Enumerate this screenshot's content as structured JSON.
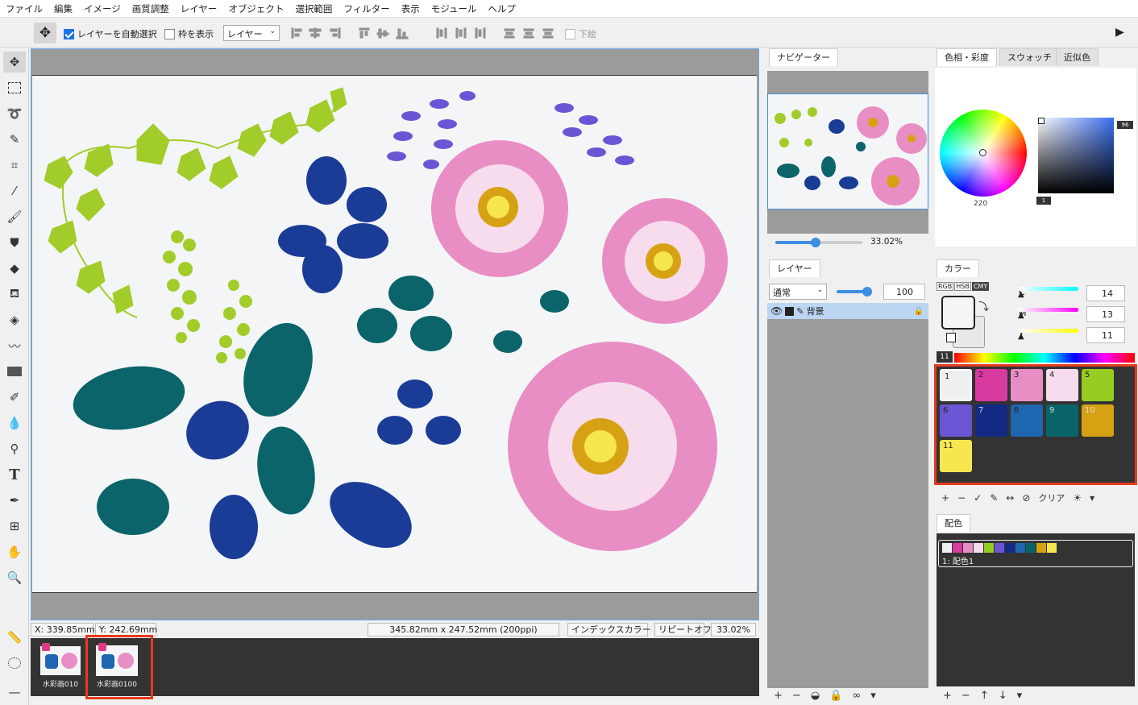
{
  "menu": [
    "ファイル",
    "編集",
    "イメージ",
    "画質調整",
    "レイヤー",
    "オブジェクト",
    "選択範囲",
    "フィルター",
    "表示",
    "モジュール",
    "ヘルプ"
  ],
  "options": {
    "auto_select_label": "レイヤーを自動選択",
    "show_bounds_label": "枠を表示",
    "target_select": "レイヤー",
    "bottom_label": "下絵"
  },
  "status": {
    "x": "X: 339.85mm",
    "y": "Y: 242.69mm",
    "size": "345.82mm x 247.52mm (200ppi)",
    "color_mode": "インデックスカラー",
    "repeat": "リピートオフ",
    "zoom": "33.02%"
  },
  "documents": [
    {
      "name": "水彩画010"
    },
    {
      "name": "水彩画0100"
    }
  ],
  "navigator": {
    "tab": "ナビゲーター",
    "zoom": "33.02%"
  },
  "layers": {
    "tab": "レイヤー",
    "blend": "通常",
    "opacity": "100",
    "items": [
      {
        "name": "背景"
      }
    ]
  },
  "color_tabs": [
    "色相・彩度",
    "スウォッチ",
    "近似色"
  ],
  "hue_value": "220",
  "sat_value": "96",
  "bright_value": "1",
  "color_panel": {
    "tab": "カラー",
    "modes": [
      "RGB",
      "HSB",
      "CMY"
    ],
    "c_label": "C",
    "c_value": "14",
    "m_label": "M",
    "m_value": "13",
    "y_label": "Y",
    "y_value": "11",
    "palette_index": "11"
  },
  "palette": [
    {
      "num": "1",
      "color": "#eeeff0"
    },
    {
      "num": "2",
      "color": "#d83aa0"
    },
    {
      "num": "3",
      "color": "#e98ec4"
    },
    {
      "num": "4",
      "color": "#f6dced"
    },
    {
      "num": "5",
      "color": "#97cc22"
    },
    {
      "num": "6",
      "color": "#6a56d4"
    },
    {
      "num": "7",
      "color": "#132a84"
    },
    {
      "num": "8",
      "color": "#1f66b0"
    },
    {
      "num": "9",
      "color": "#096469"
    },
    {
      "num": "10",
      "color": "#d6a213"
    },
    {
      "num": "11",
      "color": "#f6e650"
    }
  ],
  "palette_clear": "クリア",
  "scheme": {
    "tab": "配色",
    "item": "1: 配色1"
  }
}
